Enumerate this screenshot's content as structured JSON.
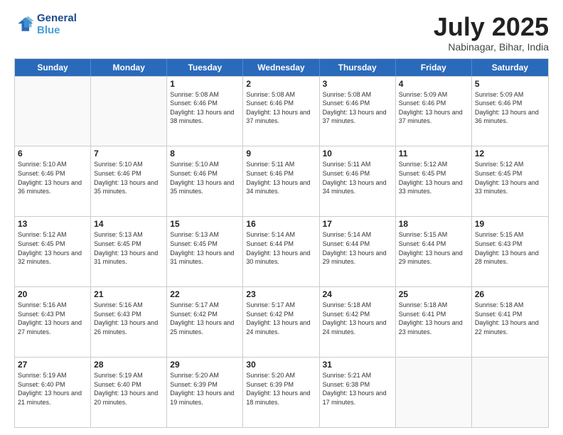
{
  "logo": {
    "line1": "General",
    "line2": "Blue"
  },
  "title": "July 2025",
  "subtitle": "Nabinagar, Bihar, India",
  "headers": [
    "Sunday",
    "Monday",
    "Tuesday",
    "Wednesday",
    "Thursday",
    "Friday",
    "Saturday"
  ],
  "weeks": [
    [
      {
        "day": "",
        "info": ""
      },
      {
        "day": "",
        "info": ""
      },
      {
        "day": "1",
        "info": "Sunrise: 5:08 AM\nSunset: 6:46 PM\nDaylight: 13 hours and 38 minutes."
      },
      {
        "day": "2",
        "info": "Sunrise: 5:08 AM\nSunset: 6:46 PM\nDaylight: 13 hours and 37 minutes."
      },
      {
        "day": "3",
        "info": "Sunrise: 5:08 AM\nSunset: 6:46 PM\nDaylight: 13 hours and 37 minutes."
      },
      {
        "day": "4",
        "info": "Sunrise: 5:09 AM\nSunset: 6:46 PM\nDaylight: 13 hours and 37 minutes."
      },
      {
        "day": "5",
        "info": "Sunrise: 5:09 AM\nSunset: 6:46 PM\nDaylight: 13 hours and 36 minutes."
      }
    ],
    [
      {
        "day": "6",
        "info": "Sunrise: 5:10 AM\nSunset: 6:46 PM\nDaylight: 13 hours and 36 minutes."
      },
      {
        "day": "7",
        "info": "Sunrise: 5:10 AM\nSunset: 6:46 PM\nDaylight: 13 hours and 35 minutes."
      },
      {
        "day": "8",
        "info": "Sunrise: 5:10 AM\nSunset: 6:46 PM\nDaylight: 13 hours and 35 minutes."
      },
      {
        "day": "9",
        "info": "Sunrise: 5:11 AM\nSunset: 6:46 PM\nDaylight: 13 hours and 34 minutes."
      },
      {
        "day": "10",
        "info": "Sunrise: 5:11 AM\nSunset: 6:46 PM\nDaylight: 13 hours and 34 minutes."
      },
      {
        "day": "11",
        "info": "Sunrise: 5:12 AM\nSunset: 6:45 PM\nDaylight: 13 hours and 33 minutes."
      },
      {
        "day": "12",
        "info": "Sunrise: 5:12 AM\nSunset: 6:45 PM\nDaylight: 13 hours and 33 minutes."
      }
    ],
    [
      {
        "day": "13",
        "info": "Sunrise: 5:12 AM\nSunset: 6:45 PM\nDaylight: 13 hours and 32 minutes."
      },
      {
        "day": "14",
        "info": "Sunrise: 5:13 AM\nSunset: 6:45 PM\nDaylight: 13 hours and 31 minutes."
      },
      {
        "day": "15",
        "info": "Sunrise: 5:13 AM\nSunset: 6:45 PM\nDaylight: 13 hours and 31 minutes."
      },
      {
        "day": "16",
        "info": "Sunrise: 5:14 AM\nSunset: 6:44 PM\nDaylight: 13 hours and 30 minutes."
      },
      {
        "day": "17",
        "info": "Sunrise: 5:14 AM\nSunset: 6:44 PM\nDaylight: 13 hours and 29 minutes."
      },
      {
        "day": "18",
        "info": "Sunrise: 5:15 AM\nSunset: 6:44 PM\nDaylight: 13 hours and 29 minutes."
      },
      {
        "day": "19",
        "info": "Sunrise: 5:15 AM\nSunset: 6:43 PM\nDaylight: 13 hours and 28 minutes."
      }
    ],
    [
      {
        "day": "20",
        "info": "Sunrise: 5:16 AM\nSunset: 6:43 PM\nDaylight: 13 hours and 27 minutes."
      },
      {
        "day": "21",
        "info": "Sunrise: 5:16 AM\nSunset: 6:43 PM\nDaylight: 13 hours and 26 minutes."
      },
      {
        "day": "22",
        "info": "Sunrise: 5:17 AM\nSunset: 6:42 PM\nDaylight: 13 hours and 25 minutes."
      },
      {
        "day": "23",
        "info": "Sunrise: 5:17 AM\nSunset: 6:42 PM\nDaylight: 13 hours and 24 minutes."
      },
      {
        "day": "24",
        "info": "Sunrise: 5:18 AM\nSunset: 6:42 PM\nDaylight: 13 hours and 24 minutes."
      },
      {
        "day": "25",
        "info": "Sunrise: 5:18 AM\nSunset: 6:41 PM\nDaylight: 13 hours and 23 minutes."
      },
      {
        "day": "26",
        "info": "Sunrise: 5:18 AM\nSunset: 6:41 PM\nDaylight: 13 hours and 22 minutes."
      }
    ],
    [
      {
        "day": "27",
        "info": "Sunrise: 5:19 AM\nSunset: 6:40 PM\nDaylight: 13 hours and 21 minutes."
      },
      {
        "day": "28",
        "info": "Sunrise: 5:19 AM\nSunset: 6:40 PM\nDaylight: 13 hours and 20 minutes."
      },
      {
        "day": "29",
        "info": "Sunrise: 5:20 AM\nSunset: 6:39 PM\nDaylight: 13 hours and 19 minutes."
      },
      {
        "day": "30",
        "info": "Sunrise: 5:20 AM\nSunset: 6:39 PM\nDaylight: 13 hours and 18 minutes."
      },
      {
        "day": "31",
        "info": "Sunrise: 5:21 AM\nSunset: 6:38 PM\nDaylight: 13 hours and 17 minutes."
      },
      {
        "day": "",
        "info": ""
      },
      {
        "day": "",
        "info": ""
      }
    ]
  ]
}
